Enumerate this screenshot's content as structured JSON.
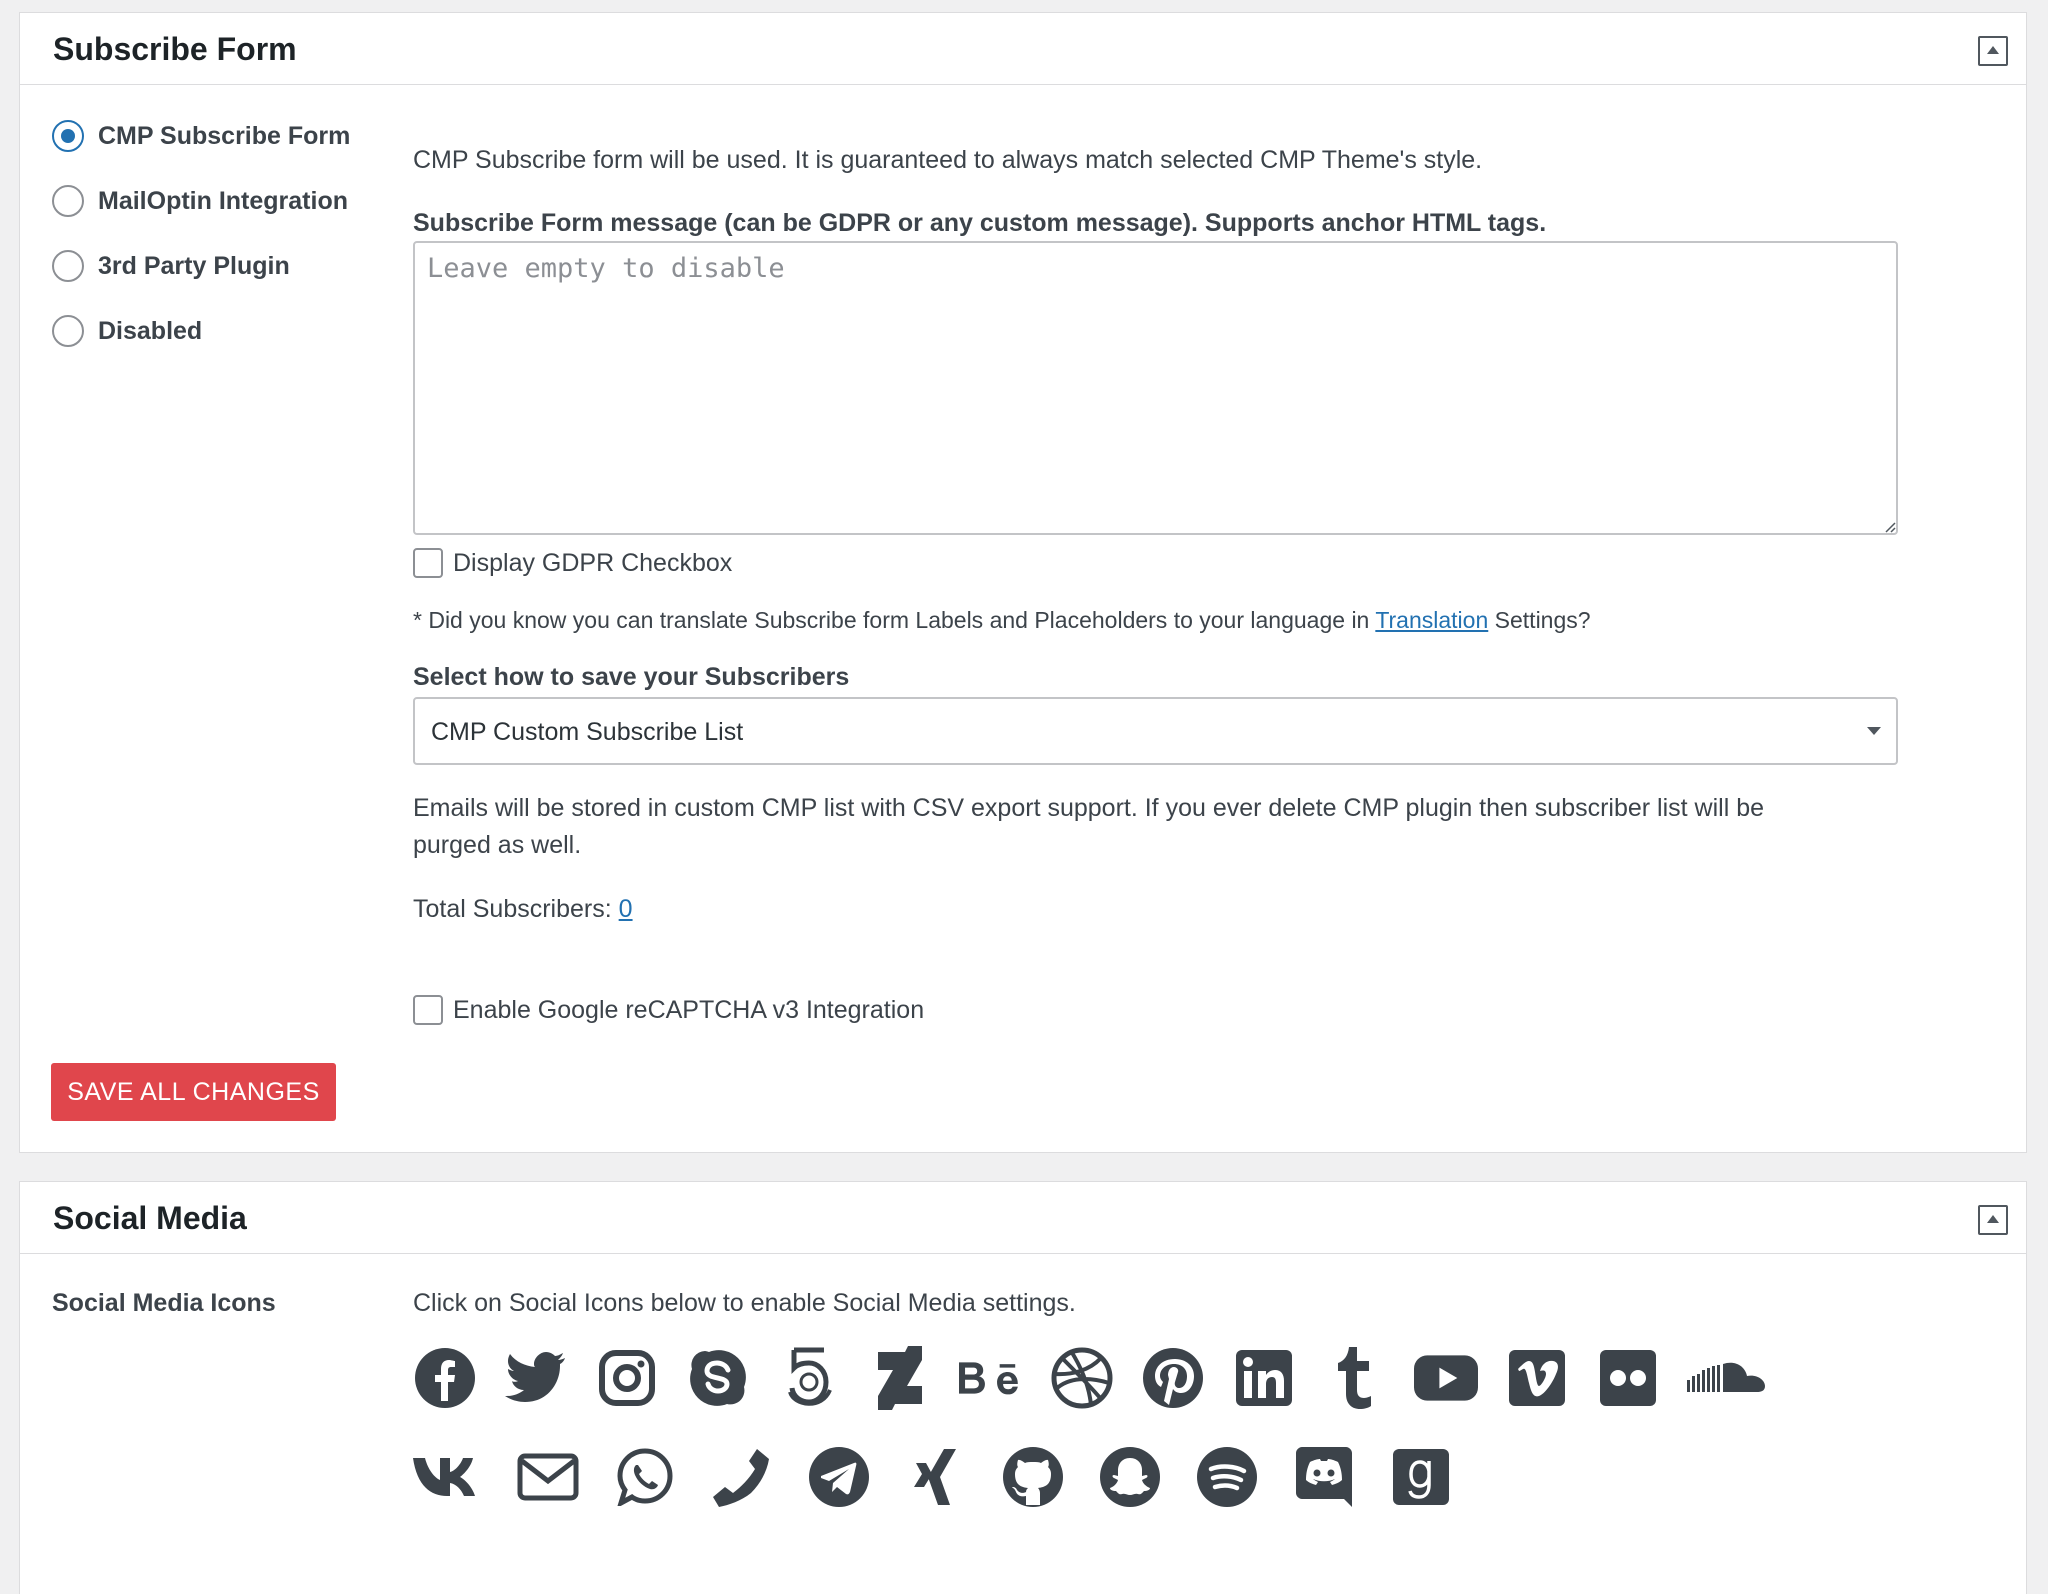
{
  "subscribe_panel": {
    "title": "Subscribe Form",
    "options": [
      {
        "label": "CMP Subscribe Form",
        "checked": true
      },
      {
        "label": "MailOptin Integration",
        "checked": false
      },
      {
        "label": "3rd Party Plugin",
        "checked": false
      },
      {
        "label": "Disabled",
        "checked": false
      }
    ],
    "description": "CMP Subscribe form will be used. It is guaranteed to always match selected CMP Theme's style.",
    "message_label": "Subscribe Form message (can be GDPR or any custom message). Supports anchor HTML tags.",
    "message_placeholder": "Leave empty to disable",
    "gdpr_checkbox_label": "Display GDPR Checkbox",
    "translation_note_prefix": "* Did you know you can translate Subscribe form Labels and Placeholders to your language in",
    "translation_link": "Translation",
    "translation_note_suffix": "Settings?",
    "save_method_label": "Select how to save your Subscribers",
    "save_method_selected": "CMP Custom Subscribe List",
    "storage_note_line1": "Emails will be stored in custom CMP list with CSV export support. If you ever delete CMP plugin then subscriber list will be",
    "storage_note_line2": "purged as well.",
    "total_subscribers_label": "Total Subscribers:",
    "total_subscribers_value": "0",
    "recaptcha_label": "Enable Google reCAPTCHA v3 Integration",
    "save_button": "SAVE ALL CHANGES"
  },
  "social_panel": {
    "title": "Social Media",
    "icons_label": "Social Media Icons",
    "instruction": "Click on Social Icons below to enable Social Media settings.",
    "icons_row1": [
      "facebook-icon",
      "twitter-icon",
      "instagram-icon",
      "skype-icon",
      "500px-icon",
      "deviantart-icon",
      "behance-icon",
      "dribbble-icon",
      "pinterest-icon",
      "linkedin-icon",
      "tumblr-icon",
      "youtube-icon",
      "vimeo-icon",
      "flickr-icon",
      "soundcloud-icon"
    ],
    "icons_row2": [
      "vk-icon",
      "email-icon",
      "whatsapp-icon",
      "phone-icon",
      "telegram-icon",
      "xing-icon",
      "github-icon",
      "snapchat-icon",
      "spotify-icon",
      "discord-icon",
      "goodreads-icon"
    ]
  },
  "colors": {
    "accent": "#2271b1",
    "save_button": "#e0464c",
    "icon": "#3c434a"
  }
}
